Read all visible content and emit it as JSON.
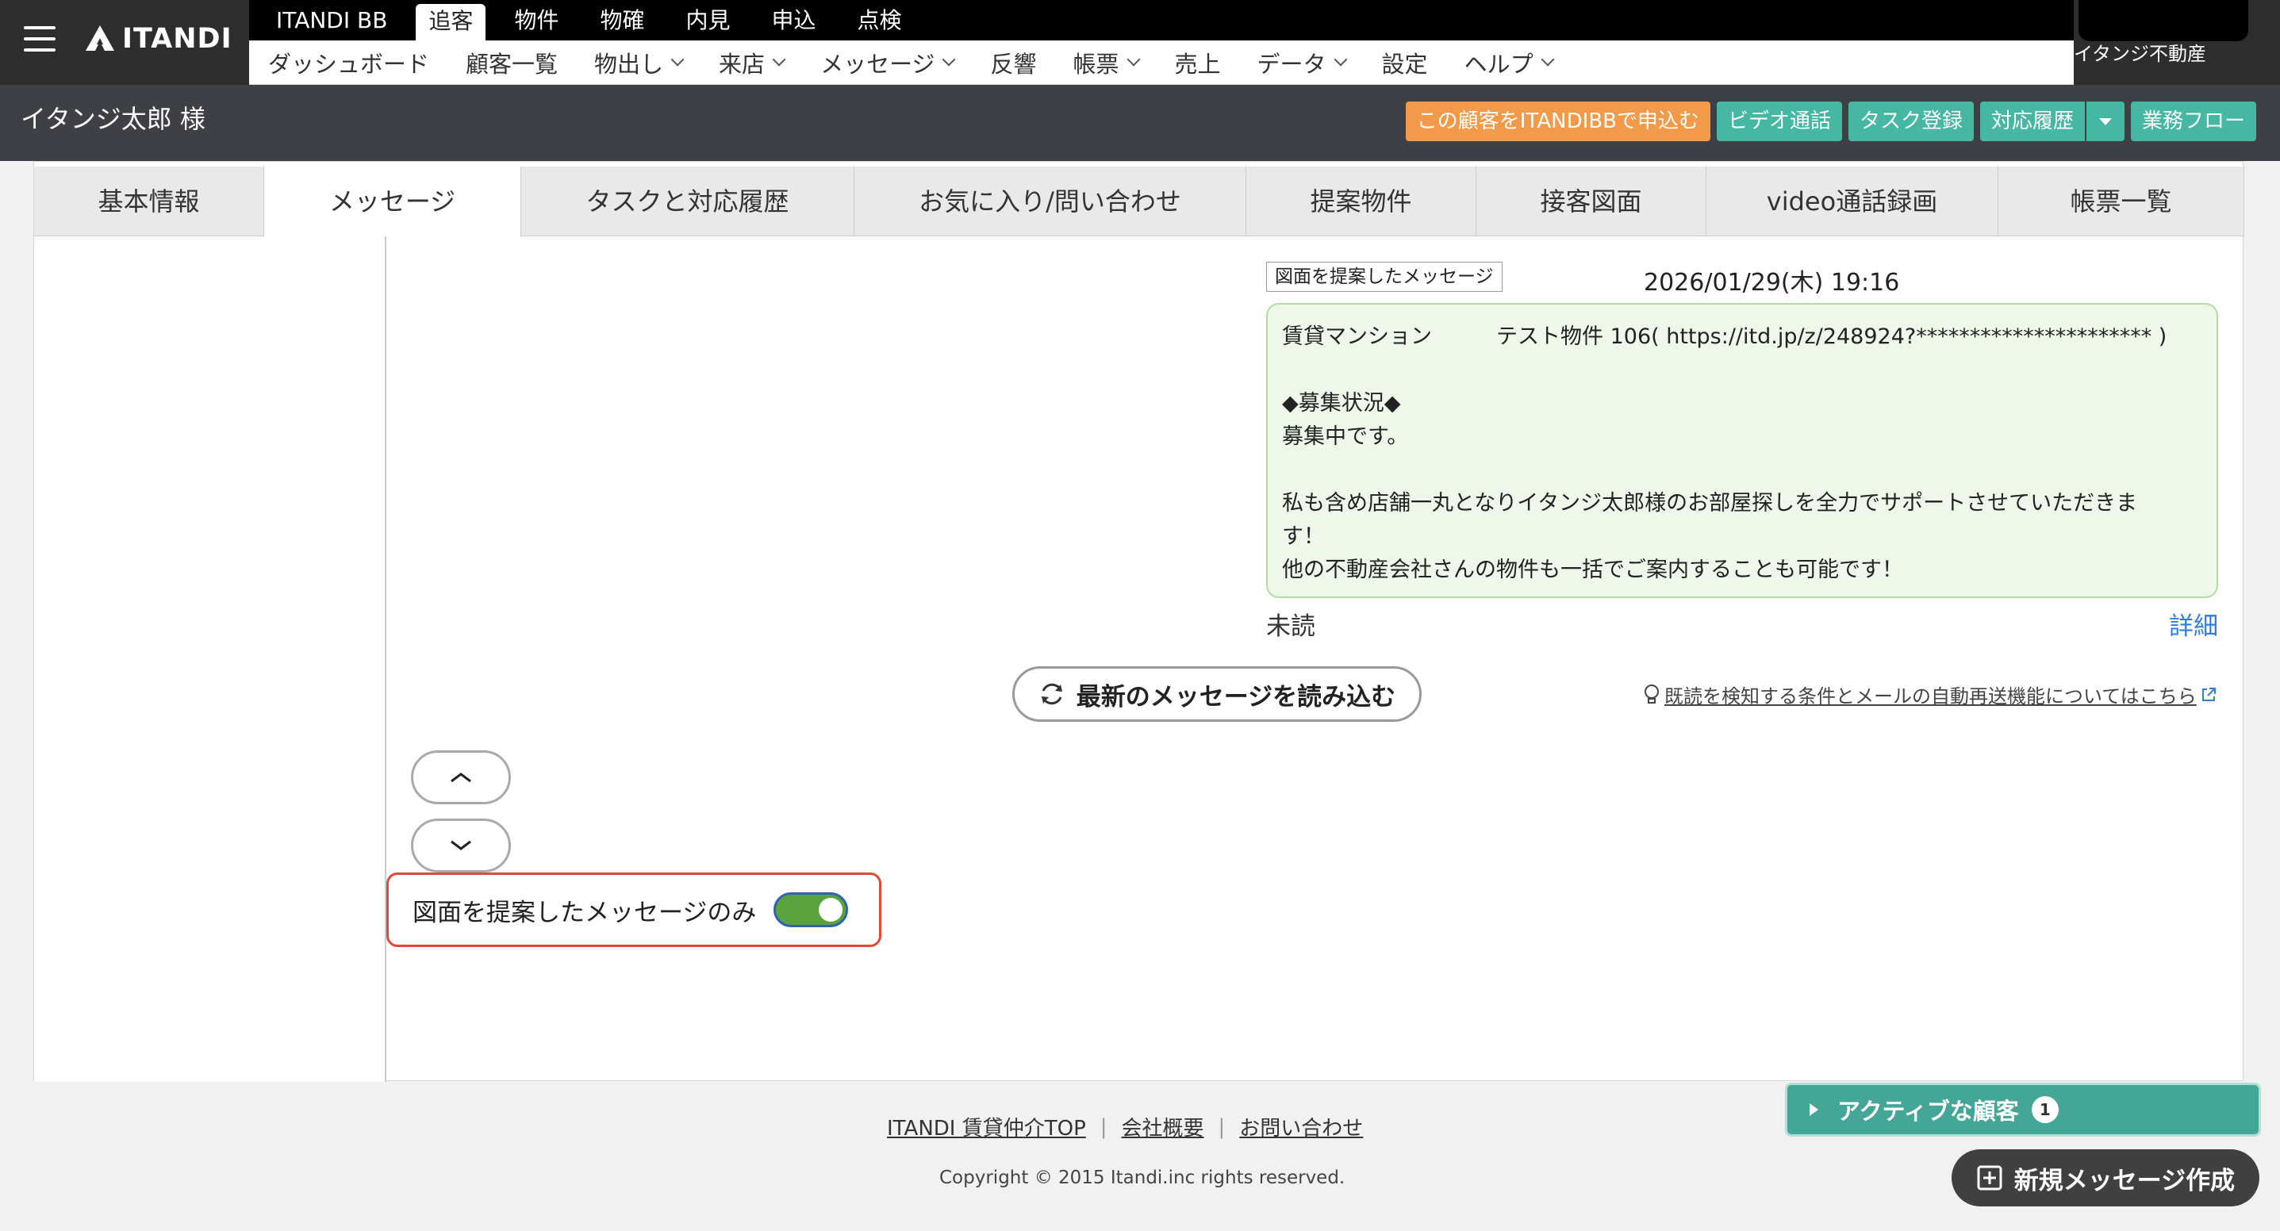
{
  "header": {
    "logo_text": "ITANDI",
    "product_tabs": [
      "ITANDI BB",
      "追客",
      "物件",
      "物確",
      "内見",
      "申込",
      "点検"
    ],
    "active_product_tab": "追客",
    "nav_items": [
      {
        "label": "ダッシュボード",
        "dropdown": false
      },
      {
        "label": "顧客一覧",
        "dropdown": false
      },
      {
        "label": "物出し",
        "dropdown": true
      },
      {
        "label": "来店",
        "dropdown": true
      },
      {
        "label": "メッセージ",
        "dropdown": true
      },
      {
        "label": "反響",
        "dropdown": false
      },
      {
        "label": "帳票",
        "dropdown": true
      },
      {
        "label": "売上",
        "dropdown": false
      },
      {
        "label": "データ",
        "dropdown": true
      },
      {
        "label": "設定",
        "dropdown": false
      },
      {
        "label": "ヘルプ",
        "dropdown": true
      }
    ],
    "company_name": "イタンジ不動産"
  },
  "customer_bar": {
    "name": "イタンジ太郎 様",
    "buttons": {
      "apply_bb": "この顧客をITANDIBBで申込む",
      "video_call": "ビデオ通話",
      "task_register": "タスク登録",
      "history": "対応履歴",
      "workflow": "業務フロー"
    }
  },
  "tabs": [
    "基本情報",
    "メッセージ",
    "タスクと対応履歴",
    "お気に入り/問い合わせ",
    "提案物件",
    "接客図面",
    "video通話録画",
    "帳票一覧"
  ],
  "active_tab": "メッセージ",
  "message": {
    "tag": "図面を提案したメッセージ",
    "date": "2026/01/29(木) 19:16",
    "lines": [
      "賃貸マンション　　　テスト物件 106( https://itd.jp/z/248924?********************** )",
      "",
      "◆募集状況◆",
      "募集中です。",
      "",
      "私も含め店舗一丸となりイタンジ太郎様のお部屋探しを全力でサポートさせていただきま",
      "す！",
      "他の不動産会社さんの物件も一括でご案内することも可能です！"
    ],
    "status": "未読",
    "detail_link": "詳細"
  },
  "reload_button": "最新のメッセージを読み込む",
  "help_link": "既読を検知する条件とメールの自動再送機能についてはこちら",
  "filter": {
    "label": "図面を提案したメッセージのみ",
    "enabled": true,
    "on_color": "#5aa33c"
  },
  "footer": {
    "links": [
      "ITANDI 賃貸仲介TOP",
      "会社概要",
      "お問い合わせ"
    ],
    "copyright": "Copyright © 2015 Itandi.inc rights reserved."
  },
  "active_customers": {
    "label": "アクティブな顧客",
    "count": "1"
  },
  "new_message_button": "新規メッセージ作成",
  "colors": {
    "accent_teal": "#45b7a2",
    "accent_orange": "#f29a4a",
    "highlight_red": "#e0483a",
    "link_blue": "#2f7de0"
  }
}
